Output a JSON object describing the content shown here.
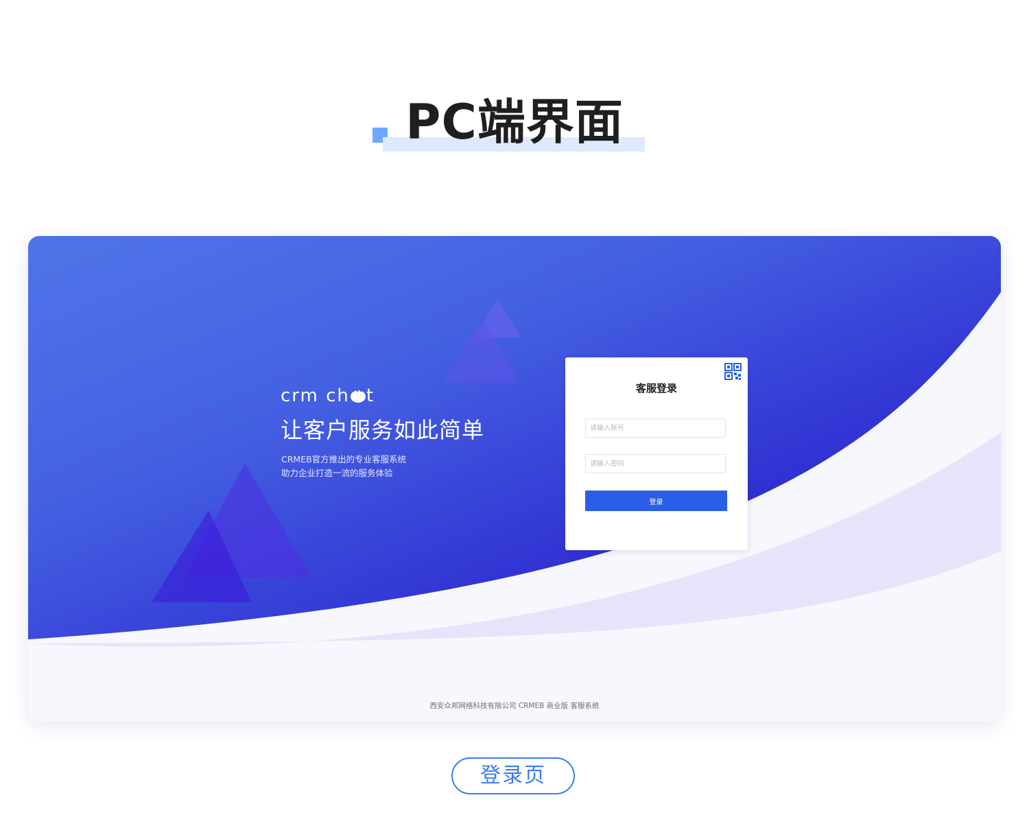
{
  "heading": {
    "title": "PC端界面"
  },
  "hero": {
    "brand": {
      "part1": "crm ch",
      "part2": "t"
    },
    "slogan": "让客户服务如此简单",
    "desc_line1": "CRMEB官方推出的专业客服系统",
    "desc_line2": "助力企业打造一流的服务体验"
  },
  "login": {
    "title": "客服登录",
    "account_placeholder": "请输入账号",
    "password_placeholder": "请输入密码",
    "submit_label": "登录",
    "qr_icon": "qr-code-icon"
  },
  "footer": {
    "text": "西安众邦网络科技有限公司 CRMEB 商业版 客服系统"
  },
  "caption": {
    "label": "登录页"
  },
  "colors": {
    "primary_blue": "#2b5ee8",
    "hero_gradient_start": "#4a6ae6",
    "hero_gradient_end": "#2a12c8",
    "accent_light": "#6fa8ff",
    "caption_blue": "#3d7bf0"
  }
}
